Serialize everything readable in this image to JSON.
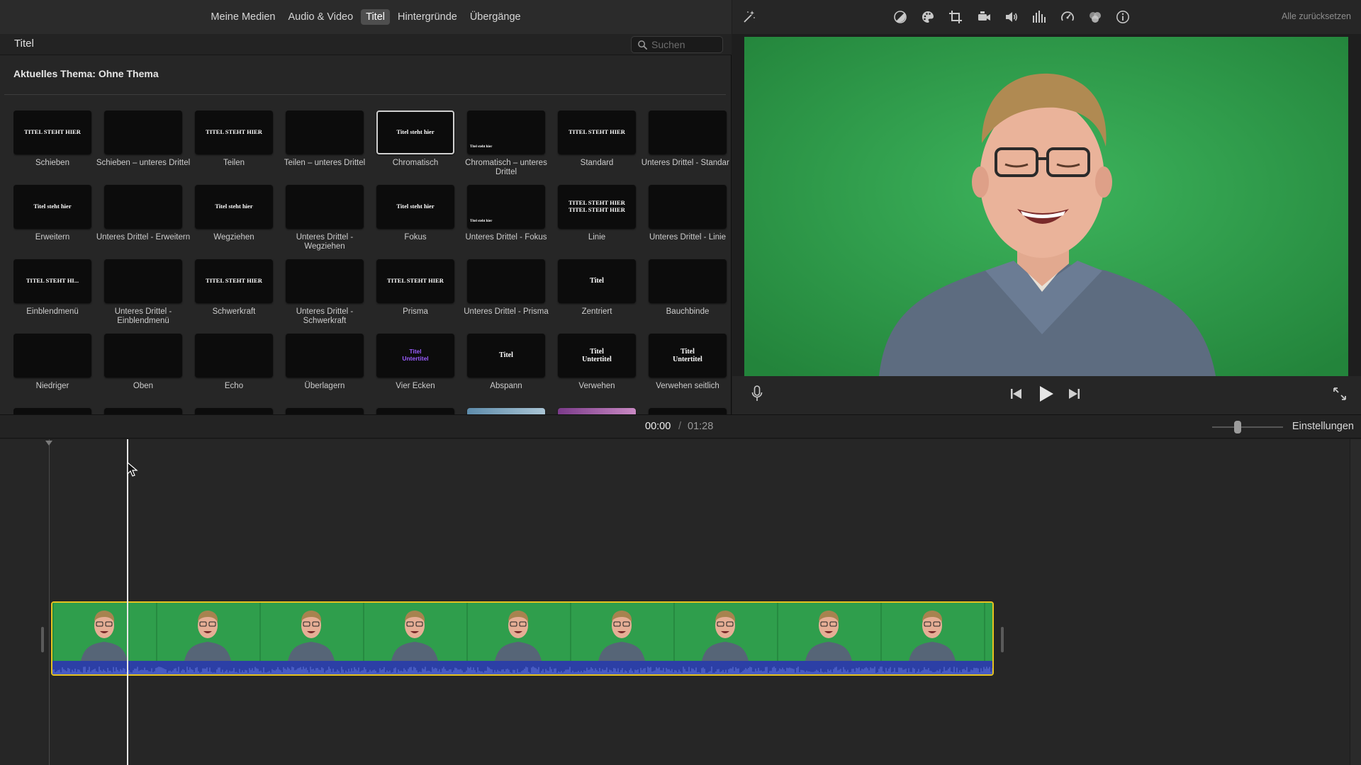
{
  "media_tabs": [
    "Meine Medien",
    "Audio & Video",
    "Titel",
    "Hintergründe",
    "Übergänge"
  ],
  "active_tab": "Titel",
  "browser": {
    "title": "Titel",
    "search_placeholder": "Suchen",
    "theme_label": "Aktuelles Thema: Ohne Thema"
  },
  "titles": [
    {
      "caption": "Schieben",
      "thumb": "TITEL STEHT HIER"
    },
    {
      "caption": "Schieben – unteres Drittel",
      "thumb": ""
    },
    {
      "caption": "Teilen",
      "thumb": "TITEL STEHT HIER"
    },
    {
      "caption": "Teilen – unteres Drittel",
      "thumb": ""
    },
    {
      "caption": "Chromatisch",
      "thumb": "Titel steht hier",
      "selected": true
    },
    {
      "caption": "Chromatisch – unteres Drittel",
      "thumb": "Titel steht hier"
    },
    {
      "caption": "Standard",
      "thumb": "TITEL STEHT HIER"
    },
    {
      "caption": "Unteres Drittel - Standard",
      "thumb": ""
    },
    {
      "caption": "Erweitern",
      "thumb": "Titel steht hier"
    },
    {
      "caption": "Unteres Drittel - Erweitern",
      "thumb": ""
    },
    {
      "caption": "Wegziehen",
      "thumb": "Titel steht hier"
    },
    {
      "caption": "Unteres Drittel - Wegziehen",
      "thumb": ""
    },
    {
      "caption": "Fokus",
      "thumb": "Titel steht hier"
    },
    {
      "caption": "Unteres Drittel - Fokus",
      "thumb": "Titel steht hier"
    },
    {
      "caption": "Linie",
      "thumb": "TITEL STEHT HIER\nTITEL STEHT HIER"
    },
    {
      "caption": "Unteres Drittel - Linie",
      "thumb": ""
    },
    {
      "caption": "Einblendmenü",
      "thumb": "TITEL STEHT HI..."
    },
    {
      "caption": "Unteres Drittel - Einblendmenü",
      "thumb": ""
    },
    {
      "caption": "Schwerkraft",
      "thumb": "TITEL STEHT HIER"
    },
    {
      "caption": "Unteres Drittel - Schwerkraft",
      "thumb": ""
    },
    {
      "caption": "Prisma",
      "thumb": "TITEL STEHT HIER"
    },
    {
      "caption": "Unteres Drittel - Prisma",
      "thumb": ""
    },
    {
      "caption": "Zentriert",
      "thumb": "Titel"
    },
    {
      "caption": "Bauchbinde",
      "thumb": ""
    },
    {
      "caption": "Niedriger",
      "thumb": ""
    },
    {
      "caption": "Oben",
      "thumb": ""
    },
    {
      "caption": "Echo",
      "thumb": ""
    },
    {
      "caption": "Überlagern",
      "thumb": ""
    },
    {
      "caption": "Vier Ecken",
      "thumb": "Titel\nUntertitel"
    },
    {
      "caption": "Abspann",
      "thumb": "Titel"
    },
    {
      "caption": "Verwehen",
      "thumb": "Titel\nUntertitel"
    },
    {
      "caption": "Verwehen seitlich",
      "thumb": "Titel\nUntertitel"
    }
  ],
  "toolbar": {
    "reset_all": "Alle zurücksetzen"
  },
  "timeline": {
    "current_time": "00:00",
    "separator": "/",
    "total_time": "01:28",
    "settings": "Einstellungen"
  },
  "colors": {
    "accent_selection": "#e6c21e",
    "green_screen": "#2ea24c",
    "audio_wave": "#2c3fa6"
  }
}
